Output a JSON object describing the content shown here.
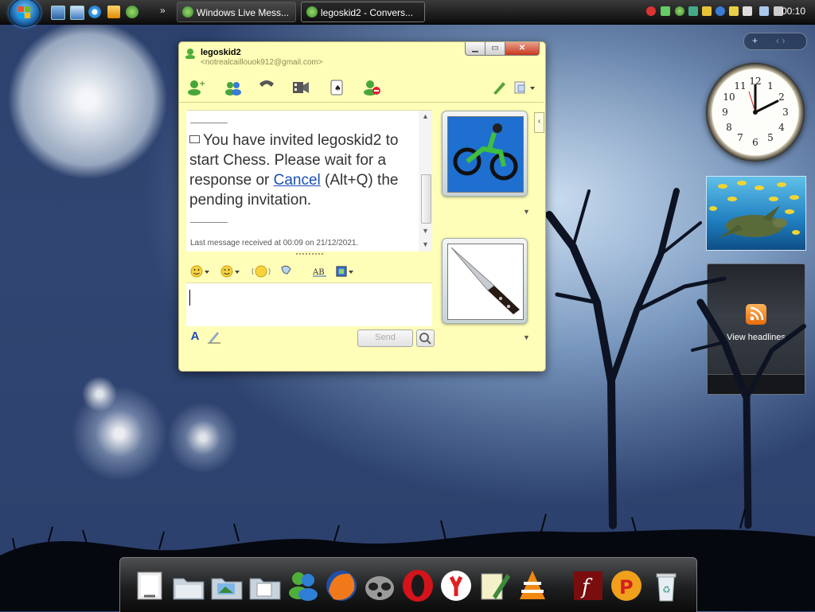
{
  "taskbar": {
    "start": "Start",
    "quick_launch": [
      "show-desktop-icon",
      "switch-windows-icon",
      "internet-explorer-icon",
      "media-player-icon",
      "messenger-icon"
    ],
    "tasks": [
      {
        "label": "Windows Live Mess...",
        "icon": "messenger-icon"
      },
      {
        "label": "legoskid2 - Convers...",
        "icon": "messenger-icon"
      }
    ],
    "clock": "00:10"
  },
  "conversation": {
    "contact_name": "legoskid2",
    "contact_email": "<notrealcaillouok912@gmail.com>",
    "toolbar": [
      "invite-icon",
      "share-files-icon",
      "call-icon",
      "video-icon",
      "games-icon",
      "block-icon",
      "themes-icon",
      "activities-icon"
    ],
    "message": {
      "before_link": "You have invited legoskid2 to start Chess. Please wait for a response or ",
      "link": "Cancel",
      "after_link": " (Alt+Q) the pending invitation."
    },
    "last_message": "Last message received at 00:09 on 21/12/2021.",
    "send_label": "Send"
  },
  "gadgets": {
    "bar_plus": "+",
    "bar_arrows": "‹  ›",
    "feed_label": "View headlines"
  },
  "dock": [
    "documents-icon",
    "folder-icon",
    "folder-pictures-icon",
    "folder-documents-icon",
    "messenger-icon",
    "firefox-icon",
    "raccoon-icon",
    "opera-icon",
    "yandex-icon",
    "notepad-icon",
    "vlc-icon",
    "flash-icon",
    "paint-icon",
    "recycle-bin-icon"
  ],
  "colors": {
    "window_bg": "#fffeb8",
    "link": "#1a4fb3",
    "taskbar": "#1a1a1a"
  }
}
